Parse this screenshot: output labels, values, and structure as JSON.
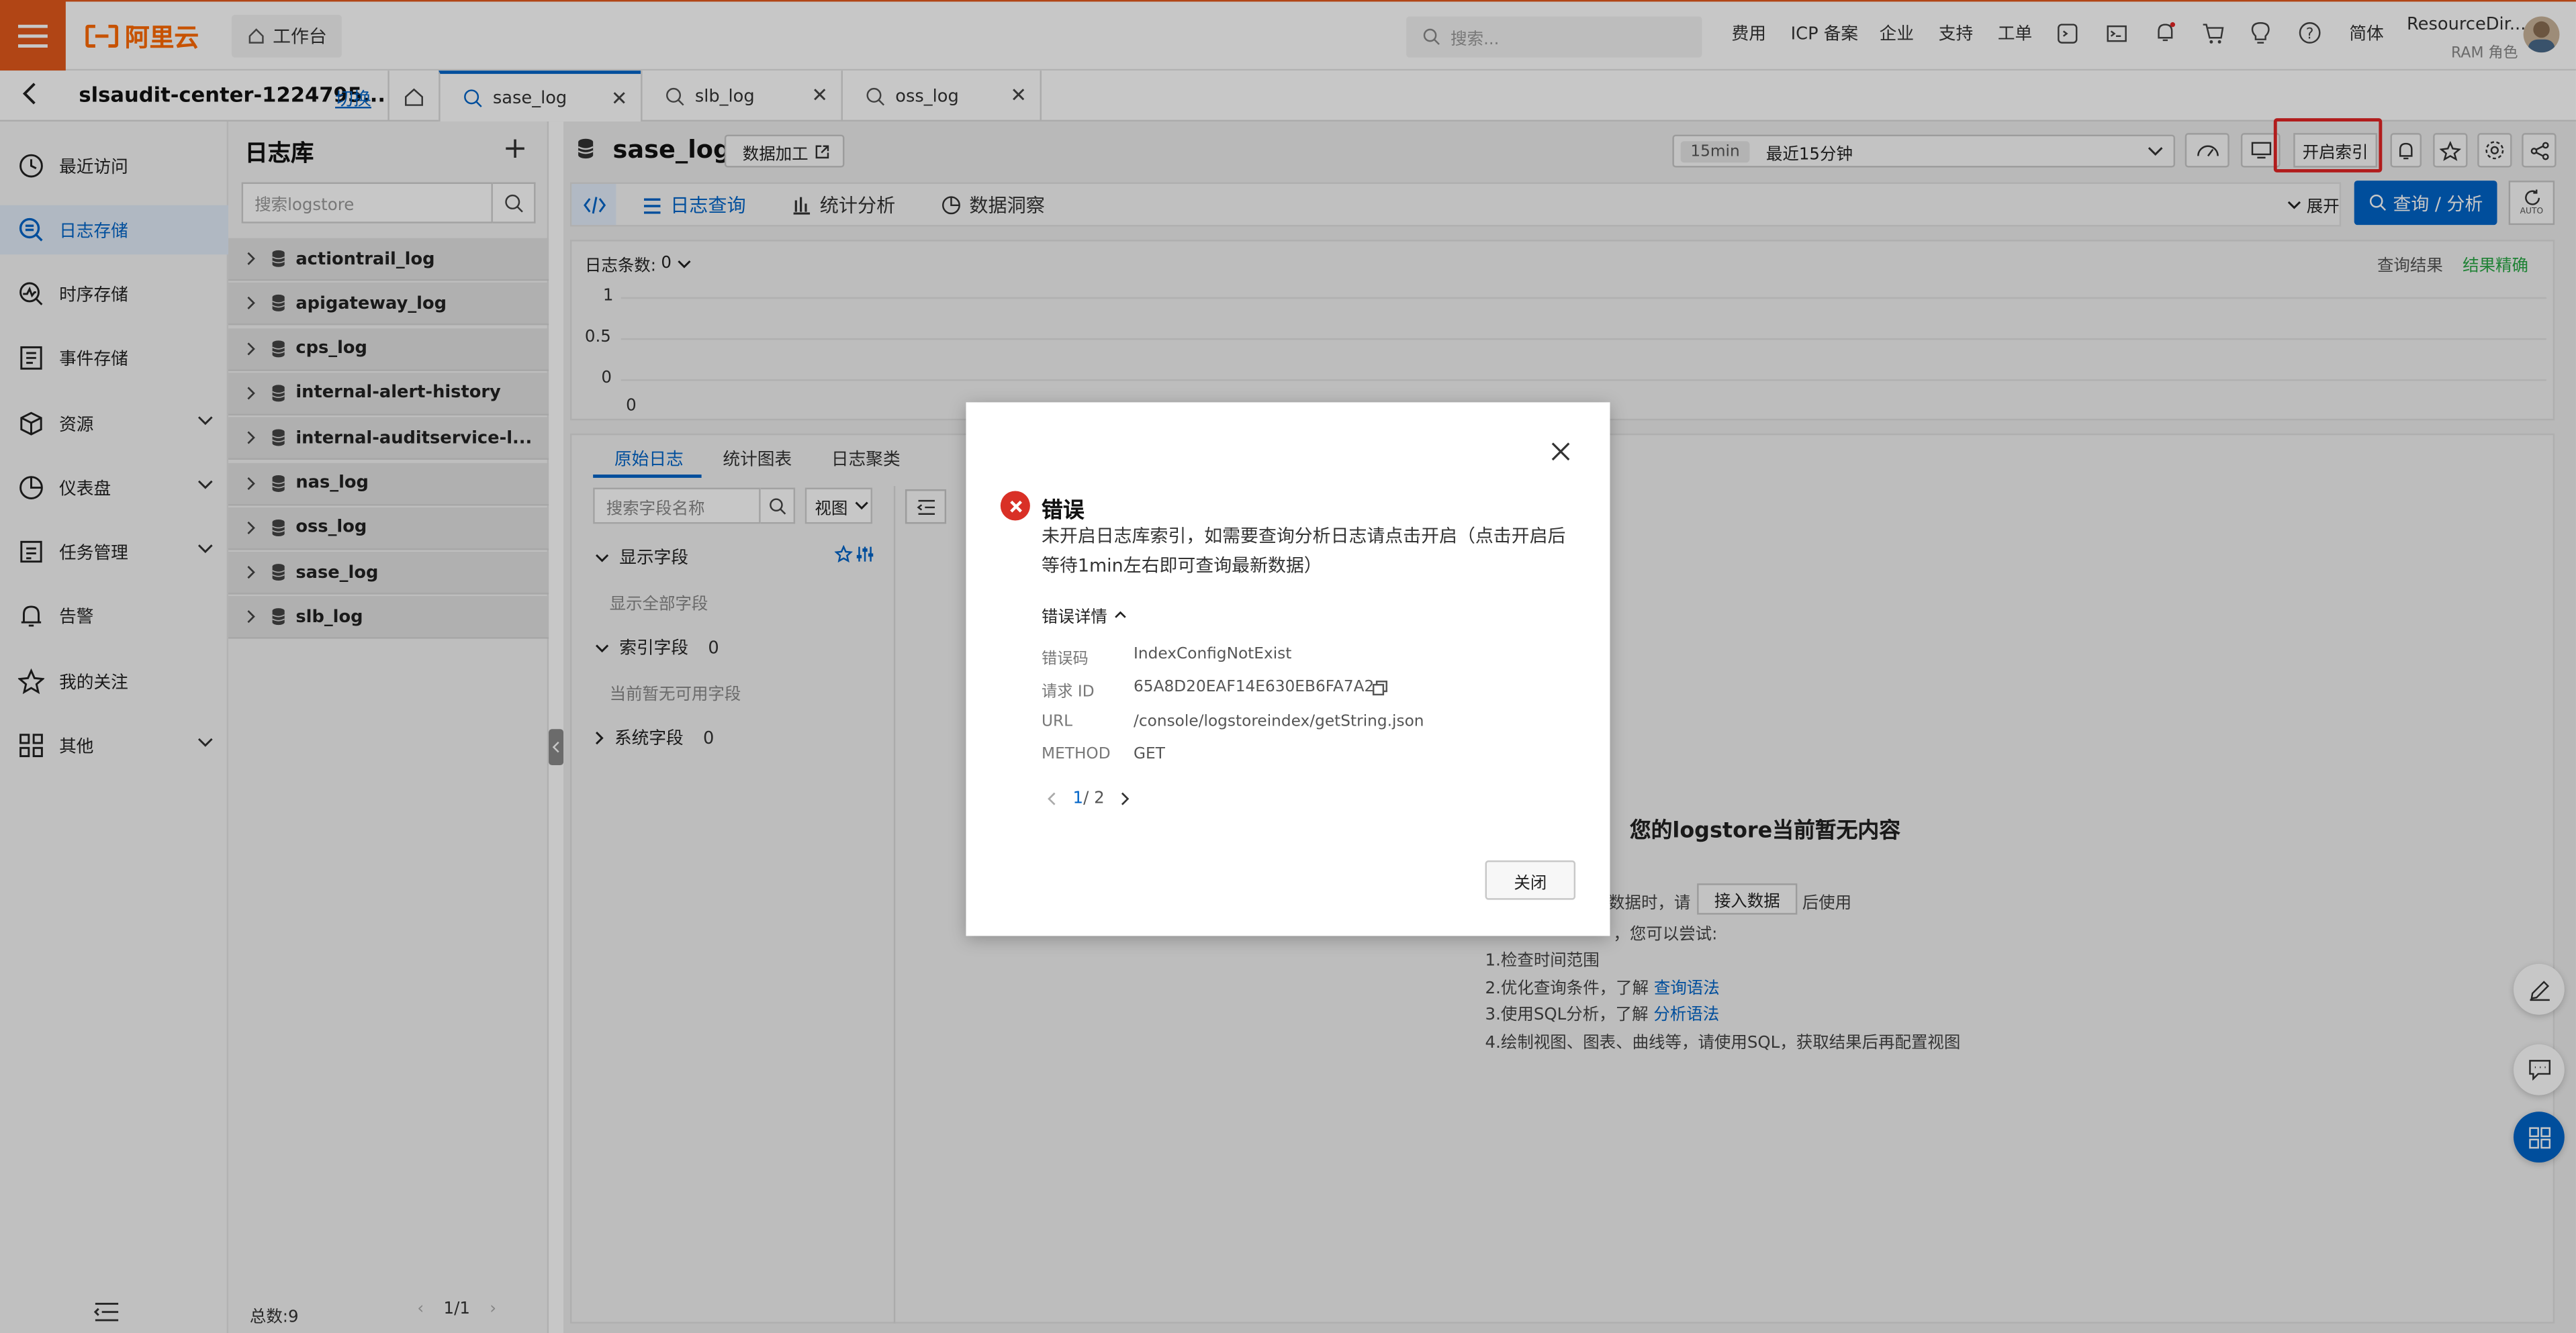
{
  "topbar": {
    "logo_text": "阿里云",
    "workbench_label": "工作台",
    "search_placeholder": "搜索...",
    "nav_items": [
      "费用",
      "ICP 备案",
      "企业",
      "支持",
      "工单"
    ],
    "lang_label": "简体",
    "user_name": "ResourceDir...",
    "user_role": "RAM 角色",
    "brand_color": "#e3591b"
  },
  "project": {
    "name": "slsaudit-center-1224795...",
    "switch_label": "切换"
  },
  "tabs": [
    {
      "label": "sase_log",
      "active": true
    },
    {
      "label": "slb_log",
      "active": false
    },
    {
      "label": "oss_log",
      "active": false
    }
  ],
  "leftnav": {
    "items": [
      {
        "label": "最近访问",
        "icon": "clock-icon",
        "expandable": false,
        "active": false
      },
      {
        "label": "日志存储",
        "icon": "log-storage-icon",
        "expandable": false,
        "active": true
      },
      {
        "label": "时序存储",
        "icon": "metric-storage-icon",
        "expandable": false,
        "active": false
      },
      {
        "label": "事件存储",
        "icon": "event-storage-icon",
        "expandable": false,
        "active": false
      },
      {
        "label": "资源",
        "icon": "cube-icon",
        "expandable": true,
        "active": false
      },
      {
        "label": "仪表盘",
        "icon": "pie-chart-icon",
        "expandable": true,
        "active": false
      },
      {
        "label": "任务管理",
        "icon": "task-icon",
        "expandable": true,
        "active": false
      },
      {
        "label": "告警",
        "icon": "bell-icon",
        "expandable": false,
        "active": false
      },
      {
        "label": "我的关注",
        "icon": "star-icon",
        "expandable": false,
        "active": false
      },
      {
        "label": "其他",
        "icon": "grid-icon",
        "expandable": true,
        "active": false
      }
    ]
  },
  "logstore_panel": {
    "title": "日志库",
    "search_placeholder": "搜索logstore",
    "items": [
      "actiontrail_log",
      "apigateway_log",
      "cps_log",
      "internal-alert-history",
      "internal-auditservice-l...",
      "nas_log",
      "oss_log",
      "sase_log",
      "slb_log"
    ],
    "total_label": "总数:9",
    "page_label": "1/1"
  },
  "main": {
    "store_title": "sase_log",
    "data_process_label": "数据加工",
    "time_badge": "15min",
    "time_label": "最近15分钟",
    "enable_index_label": "开启索引",
    "query_tabs": [
      "日志查询",
      "统计分析",
      "数据洞察"
    ],
    "expand_label": "展开",
    "query_button": "查询 / 分析",
    "auto_label": "AUTO",
    "log_count_label": "日志条数:",
    "log_count_value": "0",
    "query_result_label": "查询结果",
    "result_exact_label": "结果精确",
    "y_ticks": [
      "1",
      "0.5",
      "0",
      "0"
    ],
    "result_tabs": [
      "原始日志",
      "统计图表",
      "日志聚类"
    ],
    "field_search_placeholder": "搜索字段名称",
    "view_label": "视图",
    "display_fields_label": "显示字段",
    "show_all_fields": "显示全部字段",
    "index_fields_label": "索引字段",
    "index_fields_count": "0",
    "no_fields_text": "当前暂无可用字段",
    "system_fields_label": "系统字段",
    "system_fields_count": "0",
    "empty_title": "您的logstore当前暂无内容",
    "empty_line1_pre": "数据时，请",
    "empty_ingest_button": "接入数据",
    "empty_line1_post": "后使用",
    "empty_line2": "，您可以尝试:",
    "empty_tip1": "1.检查时间范围",
    "empty_tip2_pre": "2.优化查询条件，了解",
    "empty_tip2_link": "查询语法",
    "empty_tip3_pre": "3.使用SQL分析，了解",
    "empty_tip3_link": "分析语法",
    "empty_tip4": "4.绘制视图、图表、曲线等，请使用SQL，获取结果后再配置视图"
  },
  "dialog": {
    "title": "错误",
    "message": "未开启日志库索引，如需要查询分析日志请点击开启（点击开启后等待1min左右即可查询最新数据）",
    "details_label": "错误详情",
    "details": [
      {
        "key": "错误码",
        "value": "IndexConfigNotExist"
      },
      {
        "key": "请求 ID",
        "value": "65A8D20EAF14E630EB6FA7A2"
      },
      {
        "key": "URL",
        "value": "/console/logstoreindex/getString.json"
      },
      {
        "key": "METHOD",
        "value": "GET"
      }
    ],
    "pager_current": "1",
    "pager_total": "/ 2",
    "close_button": "关闭",
    "error_color": "#d93026"
  }
}
